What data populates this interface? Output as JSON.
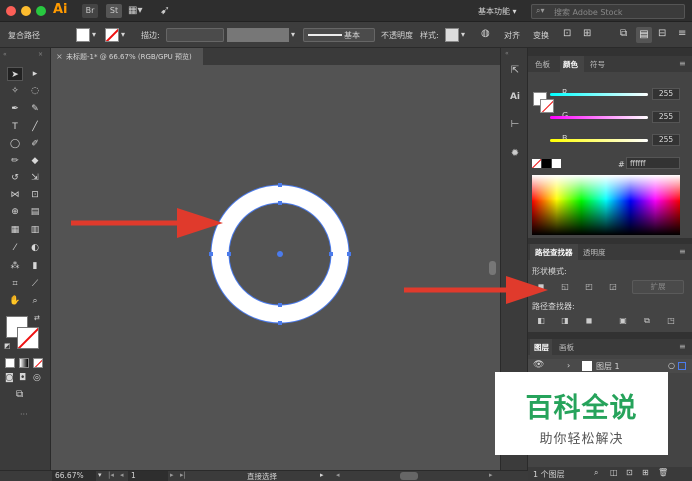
{
  "app": {
    "badge": "Ai",
    "br_badge": "Br",
    "st_badge": "St"
  },
  "titlebar": {
    "workspace": "基本功能",
    "search_placeholder": "搜索 Adobe Stock"
  },
  "controlbar": {
    "selection_type": "复合路径",
    "stroke_label": "描边:",
    "brush_label": "基本",
    "opacity_label": "不透明度",
    "style_label": "样式:",
    "align_label": "对齐",
    "transform_label": "变换"
  },
  "document": {
    "tab_title": "未标题-1* @ 66.67% (RGB/GPU 预览)",
    "close_glyph": "×"
  },
  "color_panel": {
    "tabs": [
      "色板",
      "颜色",
      "符号"
    ],
    "active_tab": 1,
    "channels": [
      {
        "label": "R",
        "value": "255"
      },
      {
        "label": "G",
        "value": "255"
      },
      {
        "label": "B",
        "value": "255"
      }
    ],
    "hex_label": "#",
    "hex_value": "ffffff"
  },
  "pathfinder_panel": {
    "tabs": [
      "路径查找器",
      "透明度"
    ],
    "shape_modes_label": "形状模式:",
    "expand_label": "扩展",
    "pathfinders_label": "路径查找器:"
  },
  "layers_panel": {
    "tabs": [
      "图层",
      "画板"
    ],
    "layer_name": "图层 1",
    "footer": "1 个图层"
  },
  "statusbar": {
    "zoom": "66.67%",
    "artboard": "1",
    "tool": "直接选择"
  },
  "watermark": {
    "title": "百科全说",
    "subtitle": "助你轻松解决"
  },
  "colors": {
    "accent_arrow": "#e03a2c",
    "selection": "#4b7bec",
    "watermark_green": "#26a35b"
  }
}
